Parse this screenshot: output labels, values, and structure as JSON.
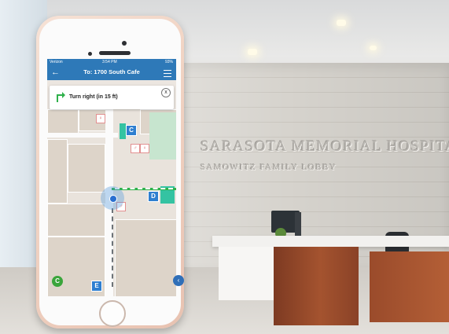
{
  "lobby": {
    "hospital_name": "SARASOTA MEMORIAL HOSPITAL",
    "lobby_name": "SAMOWITZ FAMILY LOBBY"
  },
  "status_bar": {
    "carrier": "Verizon",
    "time": "3:54 PM",
    "battery": "93%"
  },
  "nav": {
    "title": "To: 1700 South Cafe",
    "back_icon": "back-arrow-icon",
    "menu_icon": "hamburger-menu-icon"
  },
  "instruction": {
    "text": "Turn right (in 15 ft)",
    "icon": "turn-right-icon",
    "close_label": "x"
  },
  "map": {
    "markers": [
      {
        "label": "C"
      },
      {
        "label": "D"
      },
      {
        "label": "E"
      }
    ],
    "route_color": "#2fb14b",
    "location_color": "#2a6fd0"
  },
  "fab": {
    "left_label": "C",
    "right_label": "‹"
  },
  "colors": {
    "nav_bar": "#2e79b8",
    "phone_frame": "#f1d4c4"
  }
}
